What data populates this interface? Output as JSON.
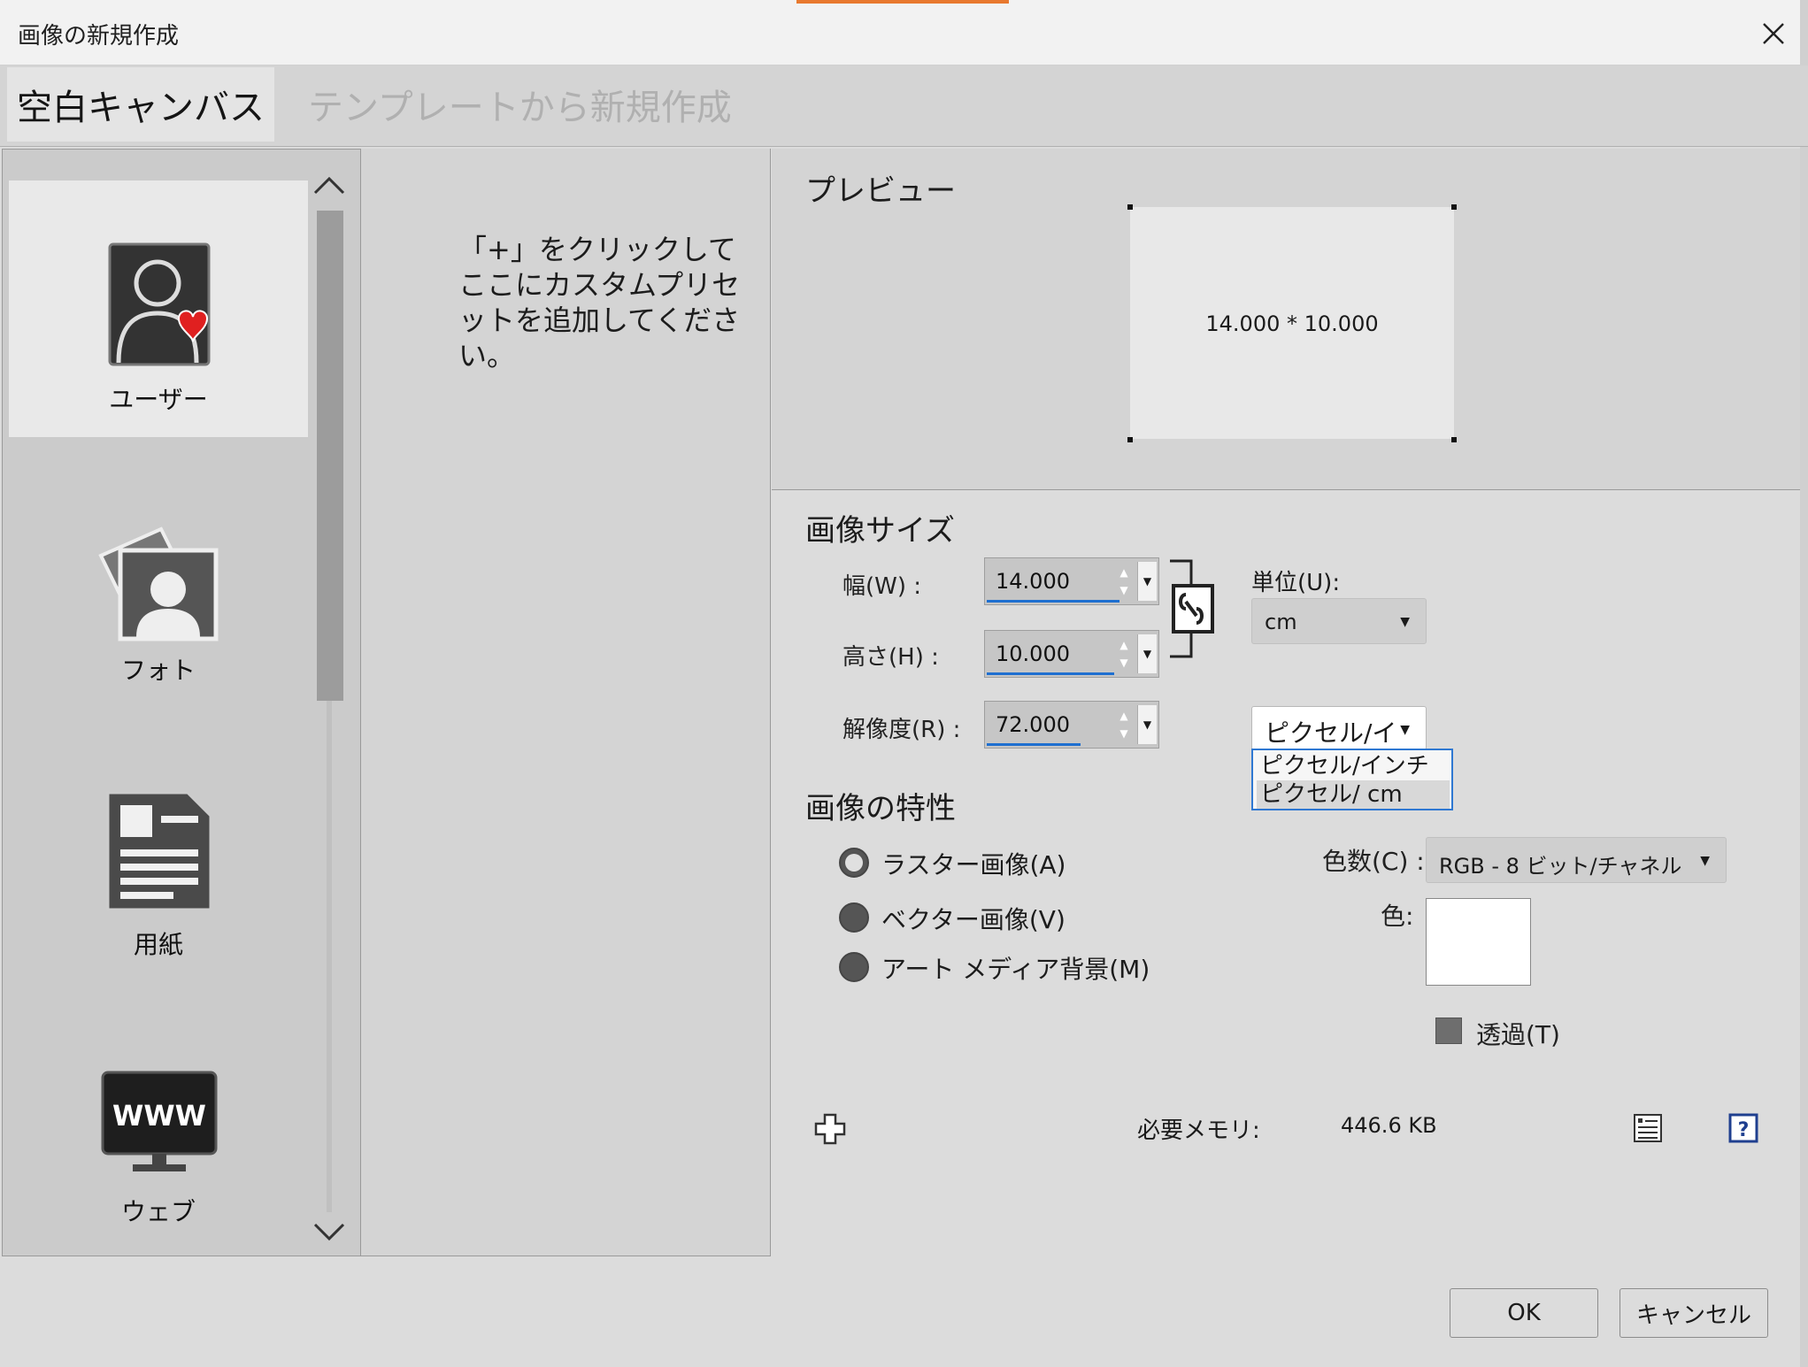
{
  "window": {
    "title": "画像の新規作成"
  },
  "tabs": [
    {
      "label": "空白キャンバス",
      "active": true
    },
    {
      "label": "テンプレートから新規作成",
      "active": false
    }
  ],
  "categories": [
    {
      "label": "ユーザー",
      "icon": "user-heart-icon",
      "selected": true
    },
    {
      "label": "フォト",
      "icon": "photo-icon",
      "selected": false
    },
    {
      "label": "用紙",
      "icon": "paper-icon",
      "selected": false
    },
    {
      "label": "ウェブ",
      "icon": "web-icon",
      "selected": false
    }
  ],
  "presets": {
    "hint": "「+」をクリックしてここにカスタムプリセットを追加してください。"
  },
  "preview": {
    "title": "プレビュー",
    "dims": "14.000 * 10.000"
  },
  "image_size": {
    "title": "画像サイズ",
    "width_label": "幅(W) :",
    "width_value": "14.000",
    "height_label": "高さ(H) :",
    "height_value": "10.000",
    "resolution_label": "解像度(R) :",
    "resolution_value": "72.000",
    "unit_label": "単位(U):",
    "unit_value": "cm",
    "res_unit_value": "ピクセル/イ",
    "res_unit_options": [
      "ピクセル/インチ",
      "ピクセル/ cm"
    ]
  },
  "properties": {
    "title": "画像の特性",
    "types": [
      {
        "label": "ラスター画像(A)",
        "checked": true
      },
      {
        "label": "ベクター画像(V)",
        "checked": false
      },
      {
        "label": "アート メディア背景(M)",
        "checked": false
      }
    ],
    "color_depth_label": "色数(C) :",
    "color_depth_value": "RGB - 8 ビット/チャネル",
    "color_label": "色:",
    "color_value": "#ffffff",
    "transparent_label": "透過(T)"
  },
  "memory": {
    "label": "必要メモリ:",
    "value": "446.6 KB"
  },
  "buttons": {
    "ok": "OK",
    "cancel": "キャンセル"
  },
  "colors": {
    "accent": "#e8792f",
    "focus": "#2f78d2",
    "underline": "#1e6fd0"
  }
}
